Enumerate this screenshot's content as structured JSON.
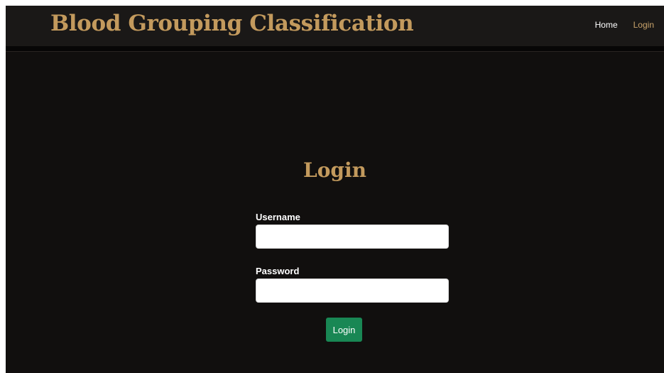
{
  "navbar": {
    "brand": "Blood Grouping Classification",
    "links": [
      {
        "label": "Home"
      },
      {
        "label": "Login"
      }
    ]
  },
  "login_form": {
    "title": "Login",
    "username": {
      "label": "Username",
      "value": "",
      "placeholder": ""
    },
    "password": {
      "label": "Password",
      "value": "",
      "placeholder": ""
    },
    "submit_label": "Login"
  },
  "colors": {
    "background": "#110f0e",
    "navbar": "#1a1817",
    "accent_gold": "#c39a5d",
    "button_green": "#198754"
  }
}
